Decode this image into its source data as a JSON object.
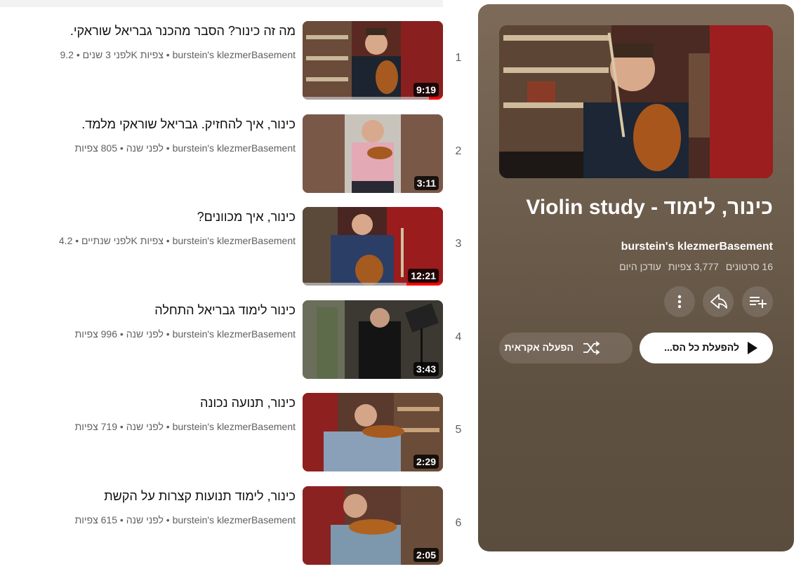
{
  "videos": [
    {
      "index": "1",
      "title": "מה זה כינור? הסבר מהכנר גבריאל שוראקי.",
      "channel": "burstein's klezmerBasement",
      "views": "9.2K צפיות",
      "age": "לפני 3 שנים",
      "duration": "9:19",
      "watched_fraction": 0.1
    },
    {
      "index": "2",
      "title": "כינור, איך להחזיק. גבריאל שוראקי מלמד.",
      "channel": "burstein's klezmerBasement",
      "views": "805 צפיות",
      "age": "לפני שנה",
      "duration": "3:11",
      "watched_fraction": 0
    },
    {
      "index": "3",
      "title": "כינור, איך מכוונים?",
      "channel": "burstein's klezmerBasement",
      "views": "4.2K צפיות",
      "age": "לפני שנתיים",
      "duration": "12:21",
      "watched_fraction": 0.26
    },
    {
      "index": "4",
      "title": "כינור לימוד גבריאל התחלה",
      "channel": "burstein's klezmerBasement",
      "views": "996 צפיות",
      "age": "לפני שנה",
      "duration": "3:43",
      "watched_fraction": 0
    },
    {
      "index": "5",
      "title": "כינור, תנועה נכונה",
      "channel": "burstein's klezmerBasement",
      "views": "719 צפיות",
      "age": "לפני שנה",
      "duration": "2:29",
      "watched_fraction": 0
    },
    {
      "index": "6",
      "title": "כינור, לימוד תנועות קצרות על הקשת",
      "channel": "burstein's klezmerBasement",
      "views": "615 צפיות",
      "age": "לפני שנה",
      "duration": "2:05",
      "watched_fraction": 0
    }
  ],
  "playlist": {
    "title": "כינור, לימוד - Violin study",
    "channel": "burstein's klezmerBasement",
    "video_count": "16 סרטונים",
    "views": "3,777 צפיות",
    "updated": "עודכן היום",
    "play_all_label": "להפעלת כל הס...",
    "shuffle_label": "הפעלה אקראית",
    "icons": [
      "playlist-add-icon",
      "share-icon",
      "more-vertical-icon",
      "play-icon",
      "shuffle-icon"
    ]
  }
}
